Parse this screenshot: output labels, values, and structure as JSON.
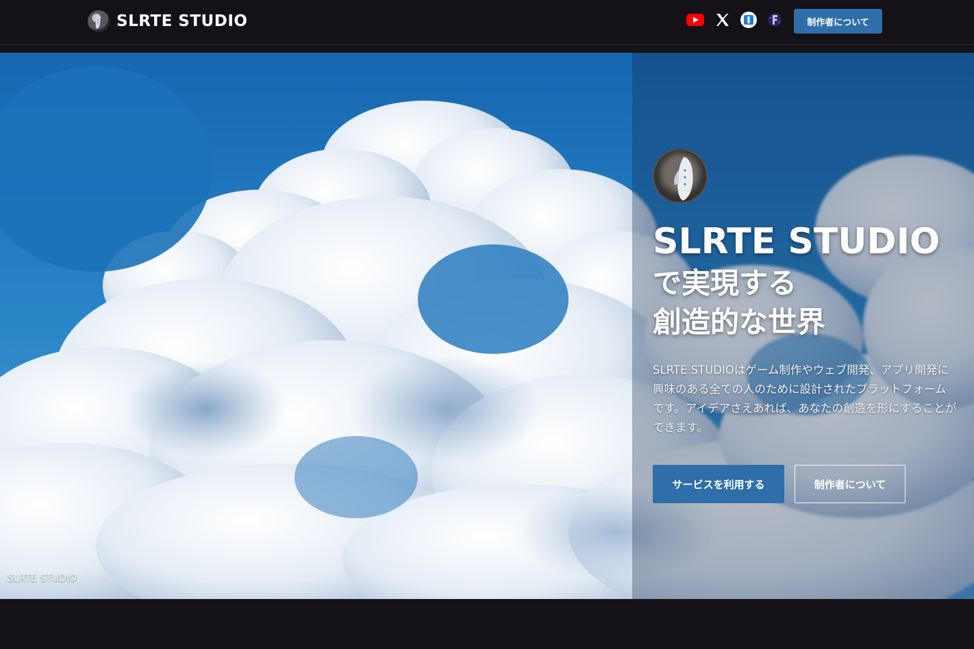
{
  "header": {
    "brand_name": "SLRTE STUDIO",
    "social_icons": [
      "youtube-icon",
      "x-icon",
      "hatena-icon",
      "f-icon"
    ],
    "about_button": "制作者について"
  },
  "hero": {
    "caption": "SLRTE STUDIO",
    "title_main": "SLRTE STUDIO",
    "title_line1": "で実現する",
    "title_line2": "創造的な世界",
    "description": "SLRTE STUDIOはゲーム制作やウェブ開発、アプリ開発に興味のある全ての人のために設計されたプラットフォームです。アイデアさえあれば、あなたの創造を形にすることができます。",
    "primary_button": "サービスを利用する",
    "secondary_button": "制作者について"
  },
  "colors": {
    "page_bg": "#141117",
    "accent": "#2f6ea9",
    "youtube": "#ff0000"
  }
}
